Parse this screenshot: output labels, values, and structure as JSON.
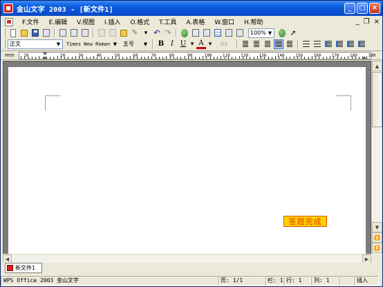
{
  "window": {
    "title": "金山文字 2003 - [新文件1]",
    "controls": {
      "minimize": "_",
      "maximize": "□",
      "close": "×"
    }
  },
  "menu": {
    "items": [
      "F.文件",
      "E.编辑",
      "V.视图",
      "I.插入",
      "O.格式",
      "T.工具",
      "A.表格",
      "W.窗口",
      "H.帮助"
    ],
    "doc_controls": {
      "minimize": "_",
      "restore": "❐",
      "close": "×"
    }
  },
  "toolbar": {
    "zoom": "100%"
  },
  "format_bar": {
    "style": "正文",
    "font": "Times New Roman",
    "size": "五号",
    "bold": "B",
    "italic": "I",
    "underline": "U",
    "font_color": "A",
    "extra_dim": "Aa",
    "font_color_value": "#cc0000"
  },
  "ruler": {
    "unit": "mm",
    "labels": [
      "10",
      "",
      "20",
      "30",
      "40",
      "50",
      "60",
      "70",
      "80",
      "90",
      "100",
      "110",
      "120",
      "130",
      "140",
      "150",
      "160",
      "170",
      "180",
      "190",
      "20"
    ]
  },
  "document": {
    "badge": "答题完成",
    "badge_color": "#ffd200"
  },
  "tabs": {
    "items": [
      "新文件1"
    ]
  },
  "status": {
    "app": "WPS Office 2003 金山文字",
    "page": "页: 1/1",
    "column": "栏: 1",
    "row": "行: 1",
    "col": "列: 1",
    "mode": "插入"
  }
}
